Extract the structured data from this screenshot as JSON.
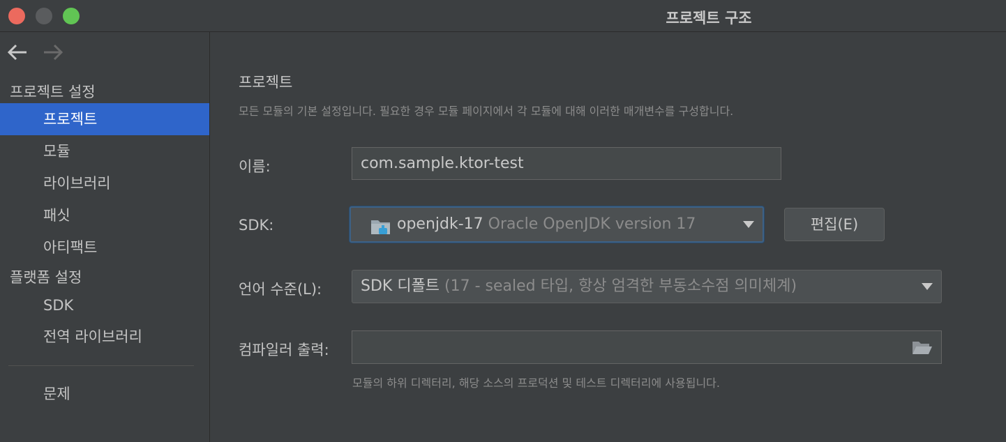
{
  "window": {
    "title": "프로젝트 구조"
  },
  "nav": {
    "back_icon": "arrow-left-icon",
    "forward_icon": "arrow-right-icon"
  },
  "sidebar": {
    "project_settings_header": "프로젝트 설정",
    "project_settings_items": [
      "프로젝트",
      "모듈",
      "라이브러리",
      "패싯",
      "아티팩트"
    ],
    "platform_settings_header": "플랫폼 설정",
    "platform_settings_items": [
      "SDK",
      "전역 라이브러리"
    ],
    "problems_item": "문제",
    "active_item": "프로젝트"
  },
  "main": {
    "title": "프로젝트",
    "description": "모든 모듈의 기본 설정입니다. 필요한 경우 모듈 페이지에서 각 모듈에 대해 이러한 매개변수를 구성합니다.",
    "name_label": "이름:",
    "name_value": "com.sample.ktor-test",
    "sdk_label": "SDK:",
    "sdk_name": "openjdk-17",
    "sdk_detail": "Oracle OpenJDK version 17",
    "sdk_edit_button": "편집(E)",
    "language_level_label": "언어 수준(L):",
    "language_level_value": "SDK 디폴트",
    "language_level_detail": "(17 - sealed 타입, 항상 엄격한 부동소수점 의미체계)",
    "compiler_output_label": "컴파일러 출력:",
    "compiler_output_value": "",
    "compiler_output_hint": "모듈의 하위 디렉터리, 해당 소스의 프로덕션 및 테스트 디렉터리에 사용됩니다."
  },
  "colors": {
    "accent": "#2f65ca",
    "background": "#3c3f41",
    "close": "#ec6a5e",
    "maximize": "#61c554"
  }
}
